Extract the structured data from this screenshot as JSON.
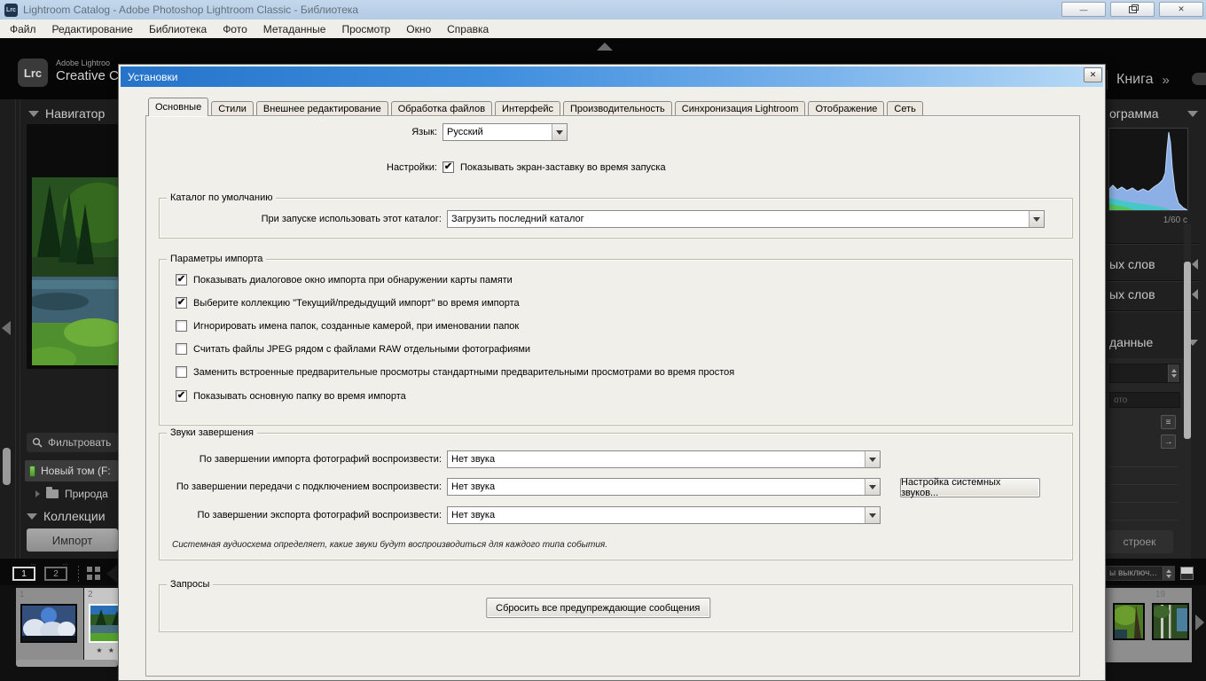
{
  "window": {
    "badge": "Lrc",
    "title": "Lightroom Catalog - Adobe Photoshop Lightroom Classic - Библиотека",
    "minimize": "—",
    "close": "✕"
  },
  "menu": {
    "items": [
      "Файл",
      "Редактирование",
      "Библиотека",
      "Фото",
      "Метаданные",
      "Просмотр",
      "Окно",
      "Справка"
    ]
  },
  "identity": {
    "badge": "Lrc",
    "line1": "Adobe Lightroo",
    "line2": "Creative Cl"
  },
  "modules": {
    "book": "Книга",
    "more": "»"
  },
  "left_panel": {
    "navigator": "Навигатор",
    "filter": "Фильтровать",
    "volume": "Новый том (F:",
    "folder": "Природа",
    "collections": "Коллекции",
    "import": "Импорт"
  },
  "right_panel": {
    "histogram": "ограмма",
    "shutter": "1/60 с",
    "keywords1": "ых слов",
    "keywords2": "ых слов",
    "metadata": "данные",
    "photo_field": "ото",
    "presets_btn": "строек",
    "list_glyph": "≡",
    "arrow_glyph": "→"
  },
  "filmstrip": {
    "btn1": "1",
    "btn2": "2",
    "dots": "…",
    "cell1_index": "1",
    "cell2_index": "2",
    "stars": "★ ★ ★ ★",
    "right_index": "19",
    "filter_label": "ы выключ..."
  },
  "dialog": {
    "title": "Установки",
    "close": "✕",
    "tabs": [
      "Основные",
      "Стили",
      "Внешнее редактирование",
      "Обработка файлов",
      "Интерфейс",
      "Производительность",
      "Синхронизация Lightroom",
      "Отображение",
      "Сеть"
    ],
    "language_label": "Язык:",
    "language_value": "Русский",
    "settings_label": "Настройки:",
    "splash_option": {
      "label": "Показывать экран-заставку во время запуска",
      "mark": "✔"
    },
    "catalog_group": {
      "title": "Каталог по умолчанию",
      "row_label": "При запуске использовать этот каталог:",
      "row_value": "Загрузить последний каталог"
    },
    "import_group": {
      "title": "Параметры импорта",
      "options": [
        {
          "label": "Показывать диалоговое окно импорта при обнаружении карты памяти",
          "mark": "✔"
        },
        {
          "label": "Выберите коллекцию \"Текущий/предыдущий импорт\" во время импорта",
          "mark": "✔"
        },
        {
          "label": "Игнорировать имена папок, созданные камерой, при именовании папок",
          "mark": ""
        },
        {
          "label": "Считать файлы JPEG рядом с файлами RAW отдельными фотографиями",
          "mark": ""
        },
        {
          "label": "Заменить встроенные предварительные просмотры стандартными предварительными просмотрами во время простоя",
          "mark": ""
        },
        {
          "label": "Показывать основную папку во время импорта",
          "mark": "✔"
        }
      ]
    },
    "sounds_group": {
      "title": "Звуки завершения",
      "rows": [
        {
          "label": "По завершении импорта фотографий воспроизвести:",
          "value": "Нет звука"
        },
        {
          "label": "По завершении передачи с подключением воспроизвести:",
          "value": "Нет звука"
        },
        {
          "label": "По завершении экспорта фотографий воспроизвести:",
          "value": "Нет звука"
        }
      ],
      "system_sounds_button": "Настройка системных звуков...",
      "note": "Системная аудиосхема определяет, какие звуки будут воспроизводиться для каждого типа события."
    },
    "prompts_group": {
      "title": "Запросы",
      "reset_button": "Сбросить все предупреждающие сообщения"
    }
  }
}
